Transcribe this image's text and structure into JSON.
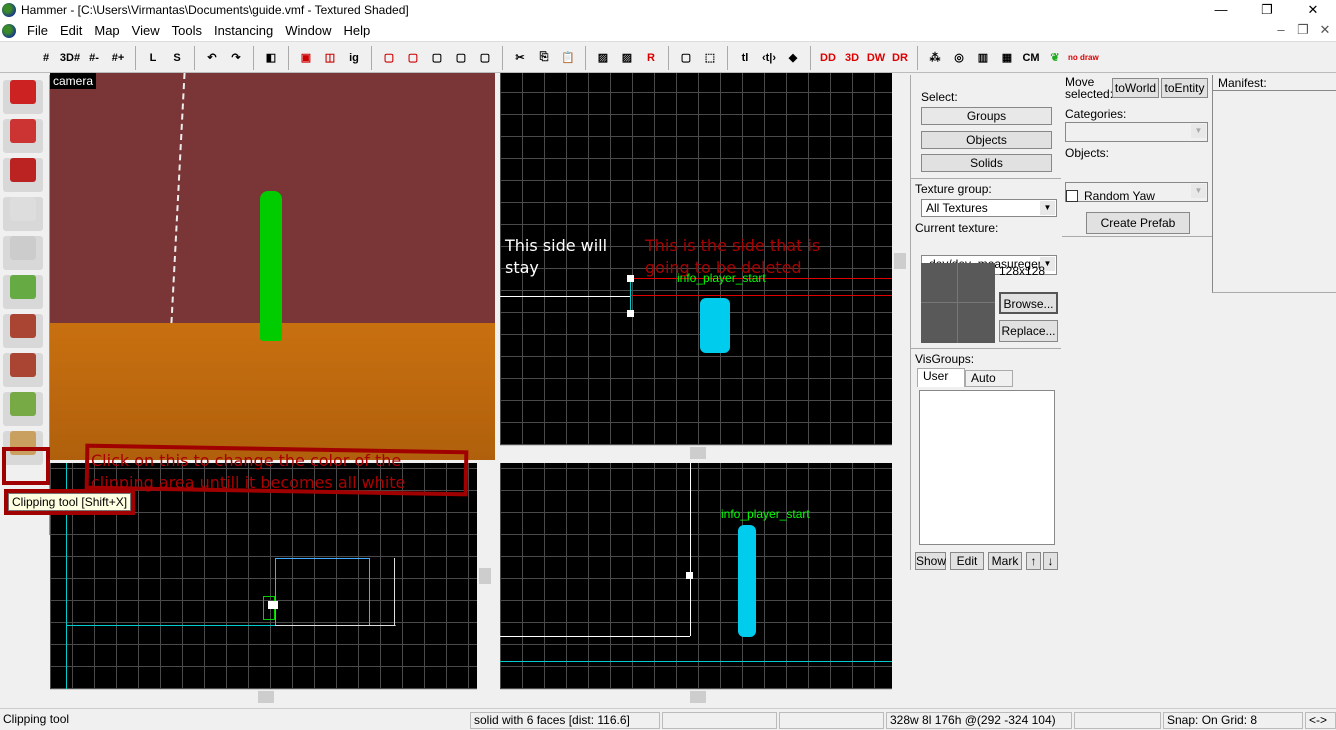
{
  "window": {
    "title": "Hammer - [C:\\Users\\Virmantas\\Documents\\guide.vmf - Textured Shaded]",
    "minimize": "—",
    "restore": "❐",
    "close": "✕",
    "doc_minimize": "–",
    "doc_restore": "❐",
    "doc_close": "✕"
  },
  "menu": [
    "File",
    "Edit",
    "Map",
    "View",
    "Tools",
    "Instancing",
    "Window",
    "Help"
  ],
  "toolbar": [
    {
      "icon": "grid-icon",
      "label": "#"
    },
    {
      "icon": "3d-grid-icon",
      "label": "3D#"
    },
    {
      "icon": "grid-smaller-icon",
      "label": "#-"
    },
    {
      "icon": "grid-larger-icon",
      "label": "#+"
    },
    {
      "icon": "load-window-state-icon",
      "label": "L"
    },
    {
      "icon": "save-window-state-icon",
      "label": "S"
    },
    {
      "icon": "undo-icon",
      "label": "↶"
    },
    {
      "icon": "redo-icon",
      "label": "↷"
    },
    {
      "icon": "carve-icon",
      "label": "◧"
    },
    {
      "icon": "group-icon",
      "label": "▣"
    },
    {
      "icon": "ungroup-icon",
      "label": "◫"
    },
    {
      "icon": "ignore-groups-icon",
      "label": "ig"
    },
    {
      "icon": "hide-selected-icon",
      "label": "▢"
    },
    {
      "icon": "hide-unselected-icon",
      "label": "▢"
    },
    {
      "icon": "show-all-icon",
      "label": "▢"
    },
    {
      "icon": "quick-hide-icon",
      "label": "▢"
    },
    {
      "icon": "visgroup-icon",
      "label": "▢"
    },
    {
      "icon": "cut-icon",
      "label": "✂"
    },
    {
      "icon": "copy-icon",
      "label": "⎘"
    },
    {
      "icon": "paste-icon",
      "label": "📋"
    },
    {
      "icon": "texture-lock-icon",
      "label": "▨"
    },
    {
      "icon": "texture-scale-lock-icon",
      "label": "▨"
    },
    {
      "icon": "radius-culling-icon",
      "label": "R"
    },
    {
      "icon": "toggle-helpers-icon",
      "label": "▢"
    },
    {
      "icon": "select-by-handles-icon",
      "label": "⬚"
    },
    {
      "icon": "text-icon",
      "label": "tl"
    },
    {
      "icon": "flip-icon",
      "label": "‹t|›"
    },
    {
      "icon": "3d-filter-icon",
      "label": "◆"
    },
    {
      "icon": "show-detail-icon",
      "label": "DD"
    },
    {
      "icon": "3d-skybox-icon",
      "label": "3D"
    },
    {
      "icon": "show-world-icon",
      "label": "DW"
    },
    {
      "icon": "show-ropes-icon",
      "label": "DR"
    },
    {
      "icon": "particles-icon",
      "label": "⁂"
    },
    {
      "icon": "wireframe-sphere-icon",
      "label": "◎"
    },
    {
      "icon": "cubemap-icon",
      "label": "▥"
    },
    {
      "icon": "blue-checker-icon",
      "label": "▦"
    },
    {
      "icon": "cm-icon",
      "label": "CM"
    },
    {
      "icon": "leaf-icon",
      "label": "❦"
    },
    {
      "icon": "nodraw-icon",
      "label": "no draw"
    }
  ],
  "palette": [
    "selection-tool",
    "magnify-tool",
    "camera-tool",
    "entity-tool",
    "block-tool",
    "texture-tool",
    "apply-texture-tool",
    "decal-tool",
    "overlay-tool",
    "clipping-tool"
  ],
  "camera": {
    "label": "camera"
  },
  "annotations": {
    "stay": "This side will stay",
    "deleted": "This is the side that is going to be deleted",
    "click": "Click on this to change the color of the clipping area untill it becomes all white"
  },
  "tooltip": "Clipping tool [Shift+X]",
  "entity_label": "info_player_start",
  "colors": {
    "annotation": "#a00000",
    "wall": "#7a3636",
    "floor": "#c06a10",
    "entity": "#00e0ff",
    "player_model": "#00c000"
  },
  "select": {
    "label": "Select:",
    "buttons": [
      "Groups",
      "Objects",
      "Solids"
    ]
  },
  "texture": {
    "group_label": "Texture group:",
    "group_value": "All Textures",
    "current_label": "Current texture:",
    "current_value": "dev/dev_measuregene",
    "size": "128x128",
    "browse": "Browse...",
    "replace": "Replace..."
  },
  "visgroups": {
    "label": "VisGroups:",
    "tabs": [
      "User",
      "Auto"
    ],
    "buttons": [
      "Show",
      "Edit",
      "Mark",
      "↑",
      "↓"
    ]
  },
  "entity_panel": {
    "move_selected": "Move selected:",
    "to_world": "toWorld",
    "to_entity": "toEntity",
    "categories": "Categories:",
    "objects": "Objects:",
    "random_yaw": "Random Yaw",
    "create_prefab": "Create Prefab"
  },
  "manifest": {
    "label": "Manifest:"
  },
  "status": {
    "left": "Clipping tool",
    "selection": "solid with 6 faces   [dist: 116.6]",
    "size": "328w 8l 176h @(292 -324 104)",
    "snap": "Snap: On Grid: 8",
    "arrows": "<->"
  }
}
